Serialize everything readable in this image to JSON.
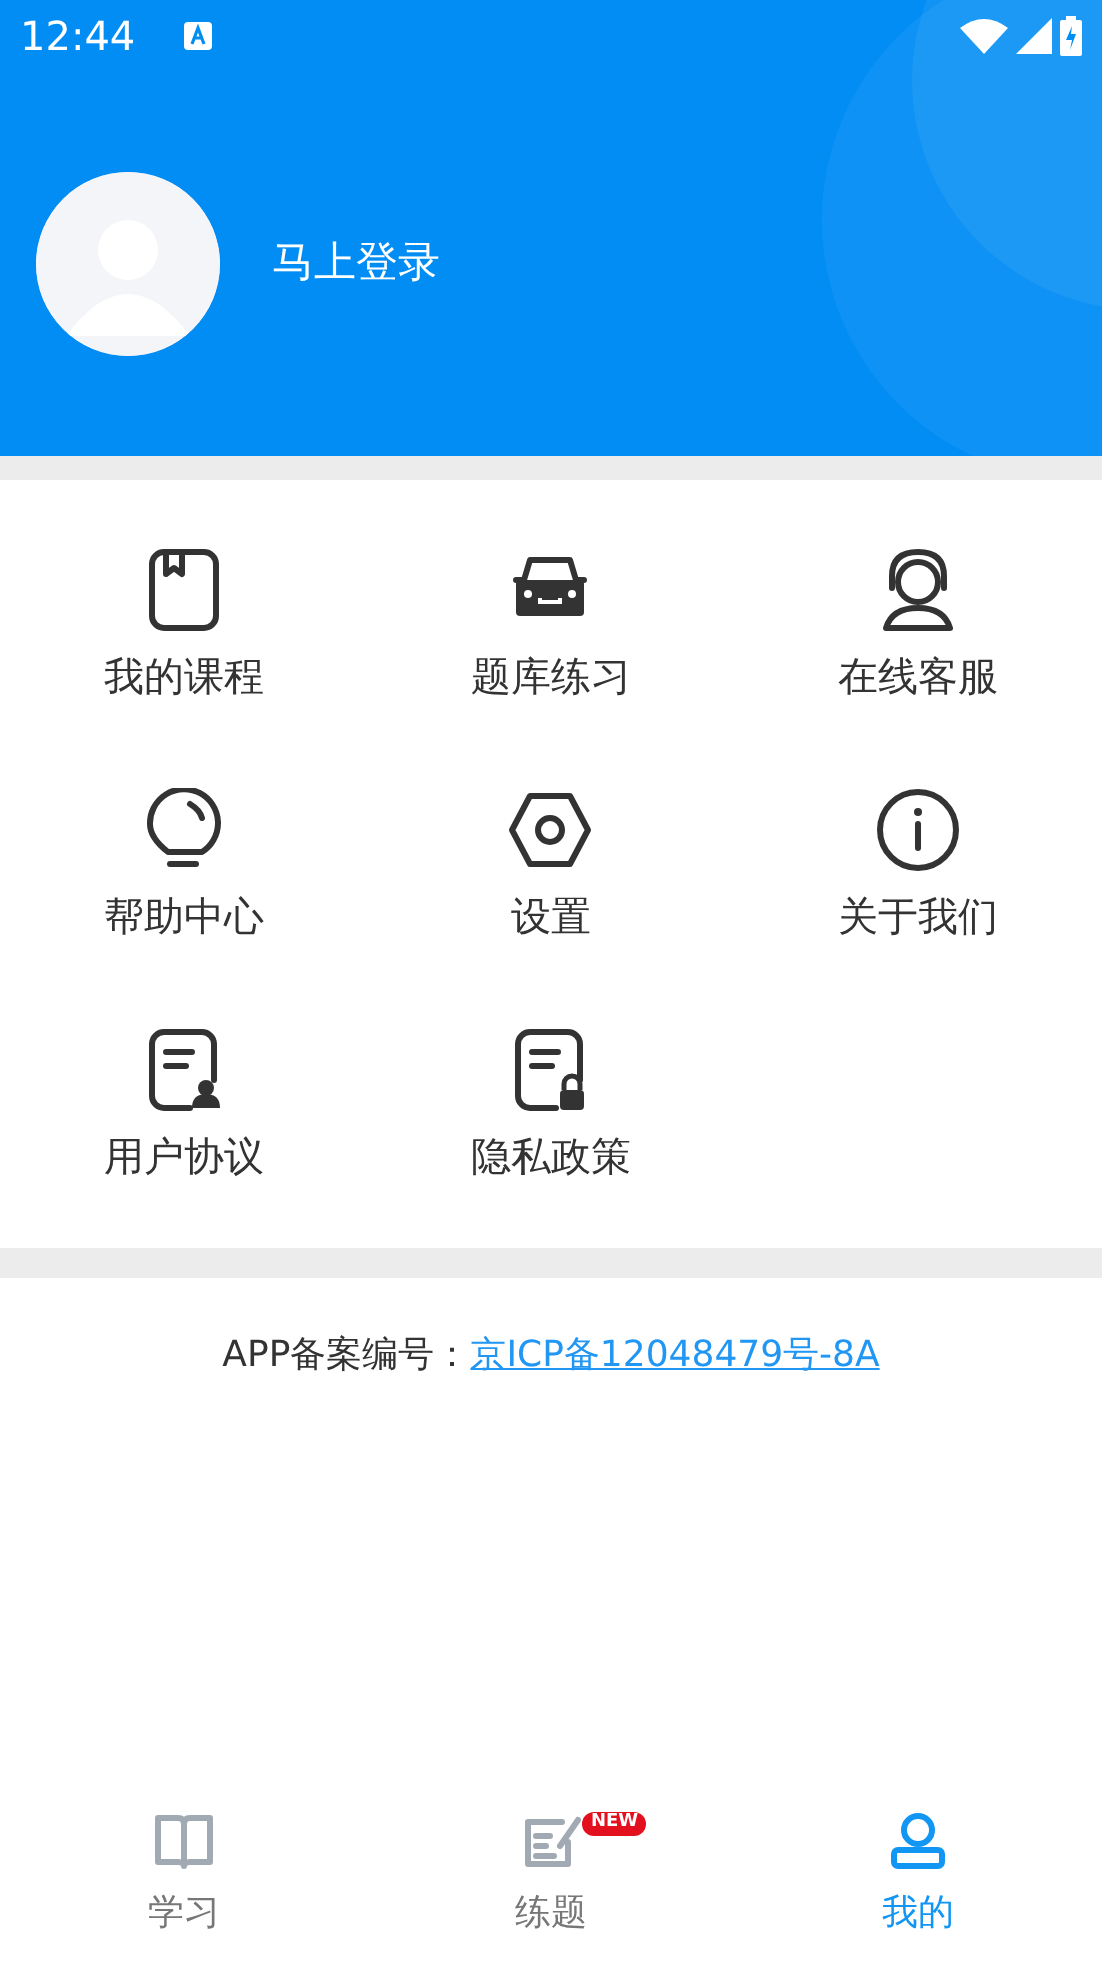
{
  "status_bar": {
    "time": "12:44"
  },
  "profile": {
    "login_label": "马上登录"
  },
  "menu": [
    {
      "label": "我的课程"
    },
    {
      "label": "题库练习"
    },
    {
      "label": "在线客服"
    },
    {
      "label": "帮助中心"
    },
    {
      "label": "设置"
    },
    {
      "label": "关于我们"
    },
    {
      "label": "用户协议"
    },
    {
      "label": "隐私政策"
    }
  ],
  "record": {
    "label": "APP备案编号：",
    "link": "京ICP备12048479号-8A"
  },
  "tabs": [
    {
      "label": "学习",
      "selected": false
    },
    {
      "label": "练题",
      "selected": false,
      "badge": "NEW"
    },
    {
      "label": "我的",
      "selected": true
    }
  ]
}
